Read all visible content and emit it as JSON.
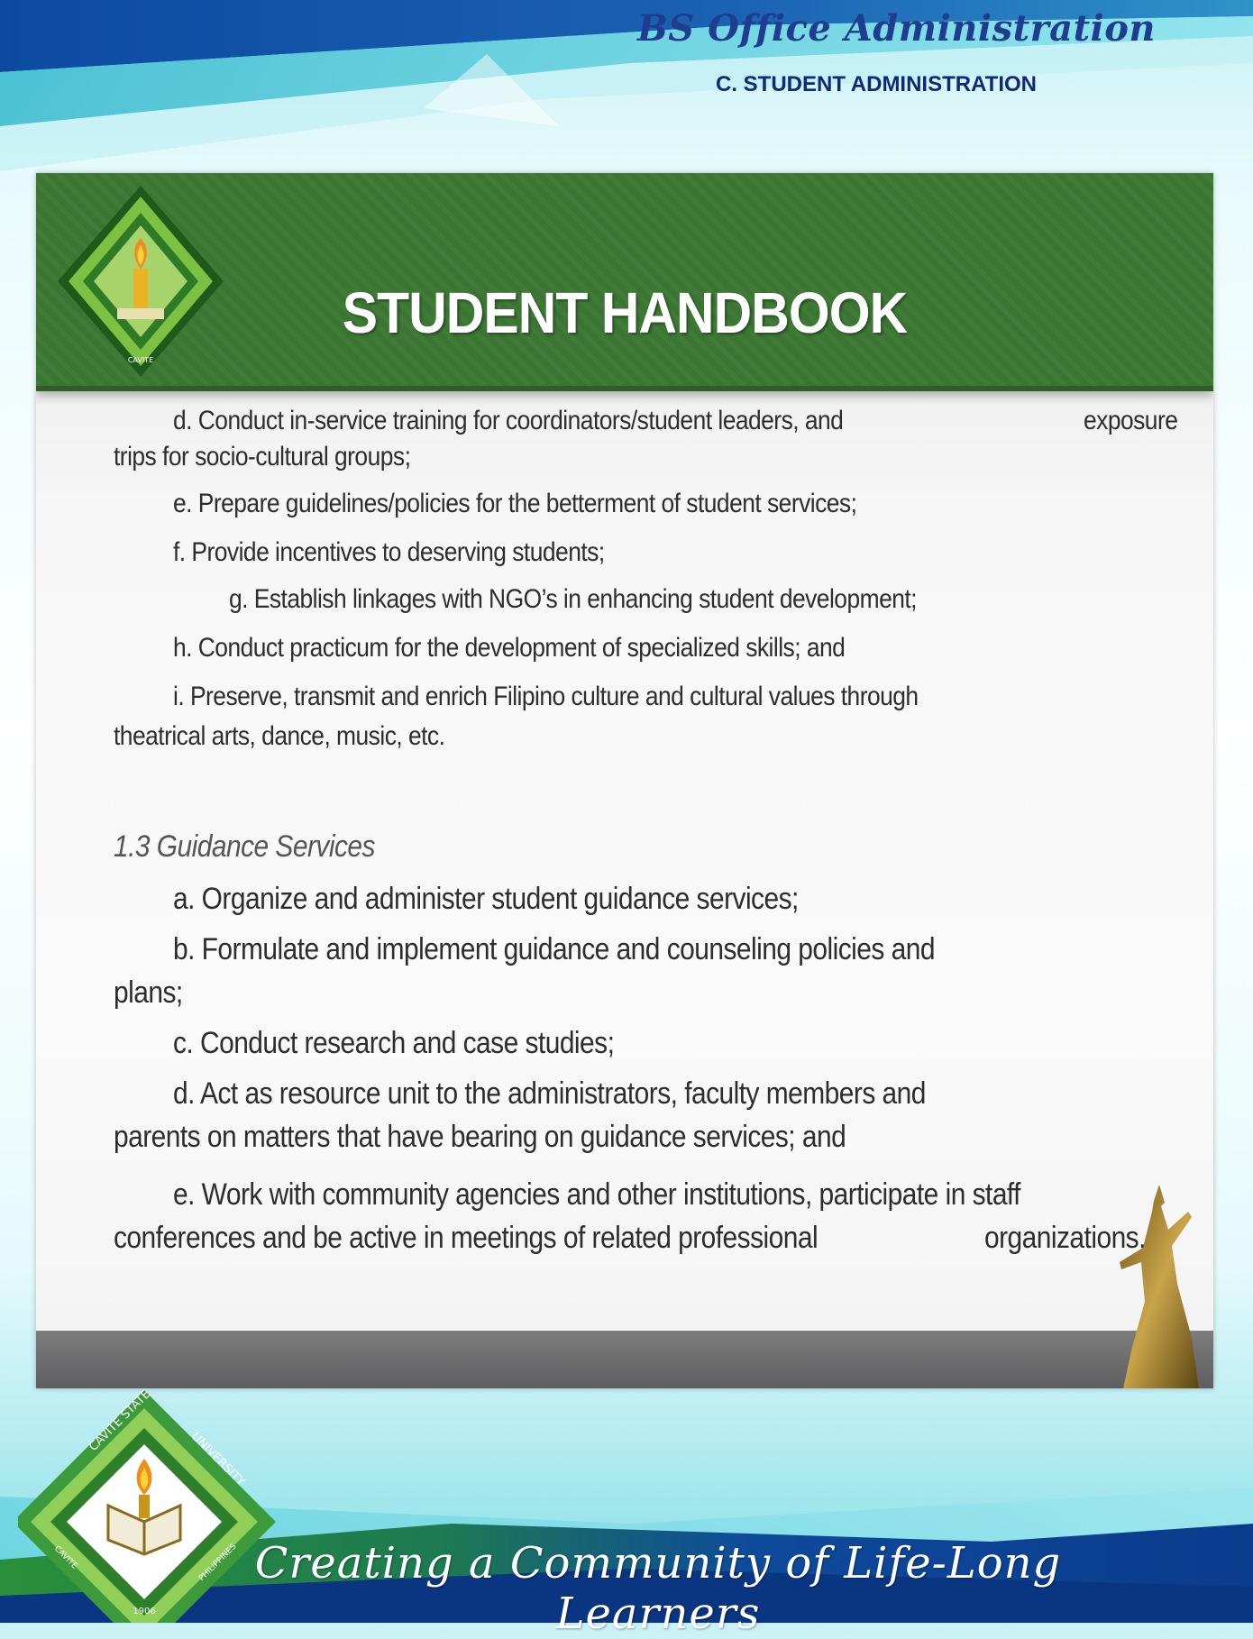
{
  "header": {
    "program": "BS Office Administration",
    "section": "C. STUDENT ADMINISTRATION"
  },
  "slide": {
    "title": "STUDENT HANDBOOK",
    "items_a": [
      {
        "text": "d.   Conduct in-service training for coordinators/student leaders, and",
        "right": "exposure"
      },
      {
        "text": "trips for socio-cultural groups;"
      },
      {
        "text": "e.    Prepare guidelines/policies for the betterment of student services;"
      },
      {
        "text": "f.     Provide incentives to deserving students;"
      },
      {
        "text": "g.    Establish linkages with NGO’s in enhancing student development;"
      },
      {
        "text": "h.    Conduct practicum for the development of specialized skills; and"
      },
      {
        "text": "i.     Preserve, transmit and enrich Filipino culture and cultural values through"
      },
      {
        "text": "theatrical arts, dance, music, etc."
      }
    ],
    "section_heading": "1.3   Guidance Services",
    "items_b": [
      {
        "text": "a.   Organize and administer student guidance services;"
      },
      {
        "text": "b.   Formulate and implement guidance and counseling policies and"
      },
      {
        "text": "plans;"
      },
      {
        "text": "c.    Conduct research and case studies;"
      },
      {
        "text": "d.    Act as resource unit to the administrators, faculty members and"
      },
      {
        "text": "parents on matters that have bearing on guidance services; and"
      },
      {
        "text": "e.   Work with community agencies and other institutions, participate in staff"
      },
      {
        "text": "conferences and be active in meetings of related professional",
        "right": "organizations."
      }
    ]
  },
  "footer": {
    "motto": "Creating a Community of Life-Long Learners",
    "seal_text": [
      "CAVITE STATE",
      "UNIVERSITY",
      "CAVITE",
      "PHILIPPINES",
      "1906"
    ]
  },
  "colors": {
    "brand_green": "#3f7a37",
    "navy": "#1f3d8f",
    "footer_blue": "#0e3f93"
  }
}
